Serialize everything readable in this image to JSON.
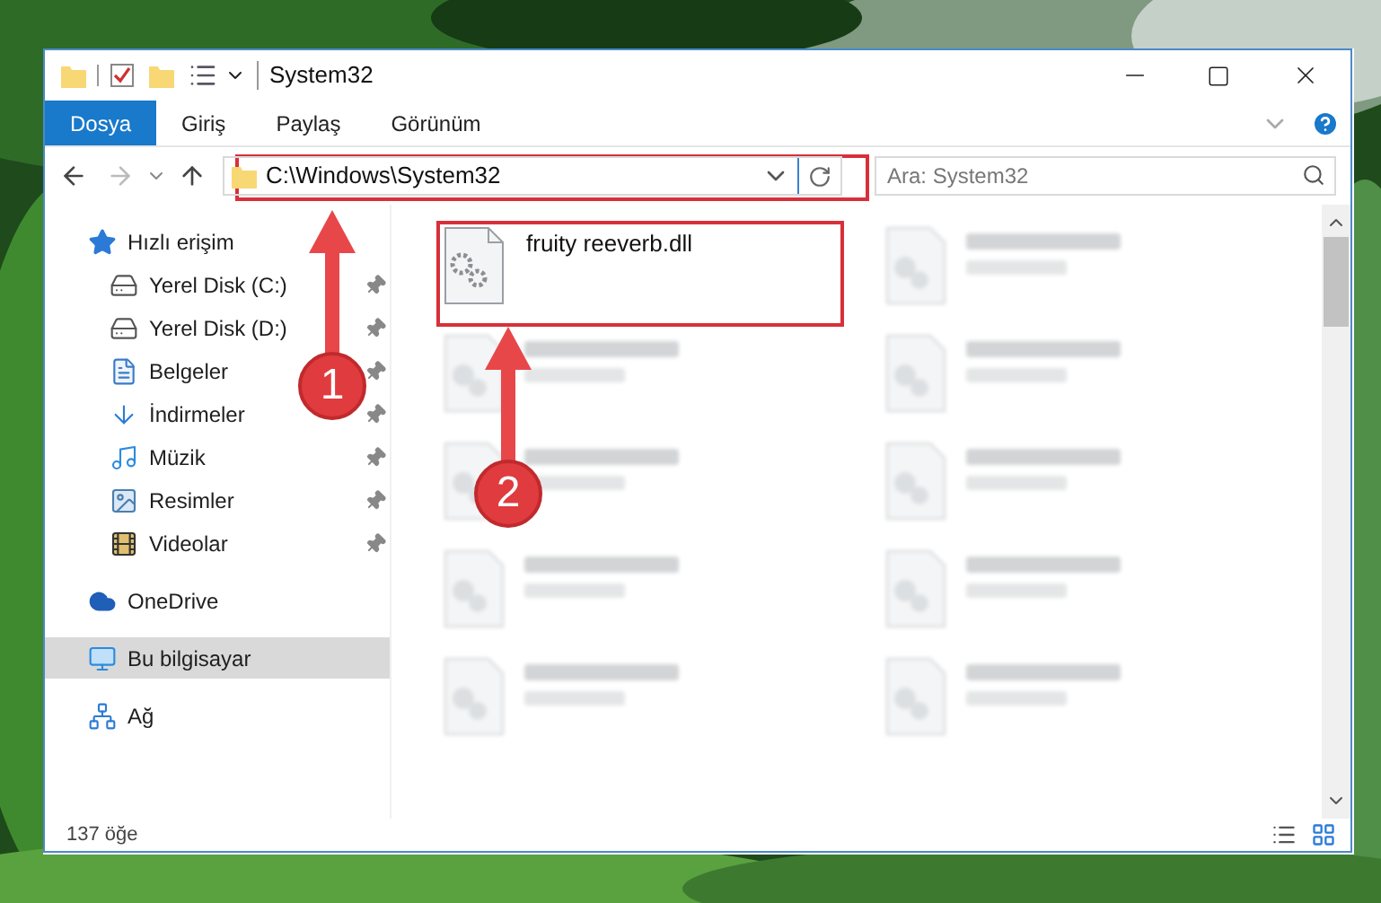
{
  "window": {
    "title": "System32"
  },
  "ribbon": {
    "tabs": [
      {
        "label": "Dosya",
        "selected": true
      },
      {
        "label": "Giriş",
        "selected": false
      },
      {
        "label": "Paylaş",
        "selected": false
      },
      {
        "label": "Görünüm",
        "selected": false
      }
    ]
  },
  "address_bar": {
    "path": "C:\\Windows\\System32"
  },
  "search": {
    "placeholder": "Ara: System32"
  },
  "sidebar": {
    "items": [
      {
        "label": "Hızlı erişim",
        "kind": "star",
        "selected": false,
        "children": [
          {
            "label": "Yerel Disk (C:)",
            "kind": "system-drive",
            "pinned": true
          },
          {
            "label": "Yerel Disk (D:)",
            "kind": "drive",
            "pinned": true
          },
          {
            "label": "Belgeler",
            "kind": "documents",
            "pinned": true
          },
          {
            "label": "İndirmeler",
            "kind": "downloads",
            "pinned": true
          },
          {
            "label": "Müzik",
            "kind": "music",
            "pinned": true
          },
          {
            "label": "Resimler",
            "kind": "pictures",
            "pinned": true
          },
          {
            "label": "Videolar",
            "kind": "videos",
            "pinned": true
          }
        ]
      },
      {
        "label": "OneDrive",
        "kind": "cloud",
        "selected": false
      },
      {
        "label": "Bu bilgisayar",
        "kind": "computer",
        "selected": true
      },
      {
        "label": "Ağ",
        "kind": "network",
        "selected": false
      }
    ]
  },
  "files": [
    {
      "kind": "file",
      "name": "fruity reeverb.dll"
    },
    {
      "kind": "blurred"
    },
    {
      "kind": "blurred"
    },
    {
      "kind": "blurred"
    },
    {
      "kind": "blurred"
    },
    {
      "kind": "blurred"
    },
    {
      "kind": "blurred"
    },
    {
      "kind": "blurred"
    },
    {
      "kind": "blurred"
    },
    {
      "kind": "blurred"
    }
  ],
  "status_bar": {
    "count": "137 öğe"
  },
  "annotations": [
    {
      "label": "1"
    },
    {
      "label": "2"
    }
  ]
}
